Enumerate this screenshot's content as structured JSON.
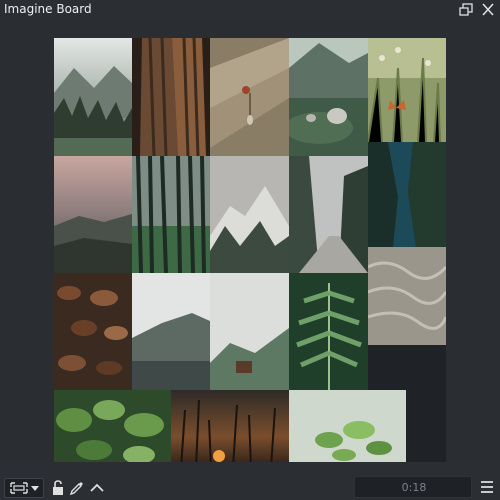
{
  "window": {
    "title": "Imagine Board",
    "float_icon": "float-window-icon",
    "close_icon": "close-icon"
  },
  "board": {
    "background": "#1f2226",
    "tiles": [
      {
        "name": "misty-mountain-forest"
      },
      {
        "name": "tree-bark-closeup"
      },
      {
        "name": "dried-flower-in-vase"
      },
      {
        "name": "teapot-on-mossy-rock"
      },
      {
        "name": "butterfly-in-meadow"
      },
      {
        "name": "pink-sky-mountain-ridge"
      },
      {
        "name": "dark-pine-forest"
      },
      {
        "name": "snowy-mountain-peaks"
      },
      {
        "name": "foggy-forest-road"
      },
      {
        "name": "aerial-lake-forest"
      },
      {
        "name": "fallen-leaves"
      },
      {
        "name": "sand-texture"
      },
      {
        "name": "misty-hills-lake"
      },
      {
        "name": "cabin-in-fog"
      },
      {
        "name": "fern-leaf"
      },
      {
        "name": "green-leaves"
      },
      {
        "name": "sunset-wildflowers"
      },
      {
        "name": "tea-plant-leaves"
      }
    ]
  },
  "toolbar": {
    "frame_icon": "frame-select-icon",
    "dropdown_icon": "chevron-down-icon",
    "lock_icon": "lock-icon",
    "picker_icon": "color-picker-icon",
    "up_icon": "chevron-up-icon",
    "timer": "0:18",
    "menu_icon": "hamburger-menu-icon"
  }
}
